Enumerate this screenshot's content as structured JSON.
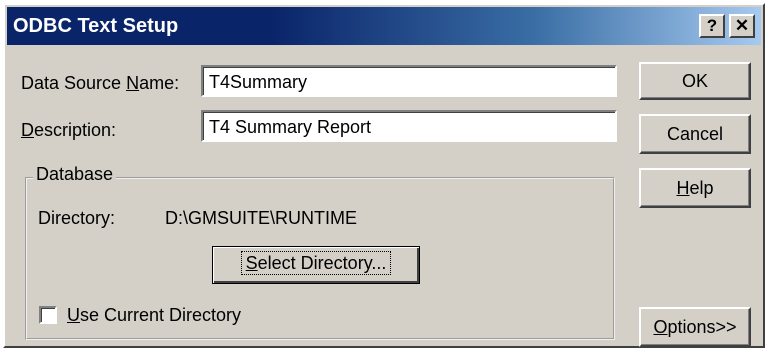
{
  "window": {
    "title": "ODBC Text Setup",
    "help_glyph": "?",
    "close_glyph": "✕"
  },
  "form": {
    "dsn_label_pre": "Data Source ",
    "dsn_label_key": "N",
    "dsn_label_post": "ame:",
    "dsn_value": "T4Summary",
    "desc_label_key": "D",
    "desc_label_post": "escription:",
    "desc_value": "T4 Summary Report"
  },
  "database": {
    "legend": "Database",
    "directory_label": "Directory:",
    "directory_value": "D:\\GMSUITE\\RUNTIME",
    "select_key": "S",
    "select_post": "elect Directory...",
    "use_current_key": "U",
    "use_current_post": "se Current Directory",
    "use_current_checked": false
  },
  "buttons": {
    "ok": "OK",
    "cancel": "Cancel",
    "help_key": "H",
    "help_post": "elp",
    "options_key": "O",
    "options_post": "ptions>>"
  },
  "colors": {
    "face": "#d4d0c8",
    "titlebar_start": "#0a246a",
    "titlebar_end": "#a6caf0"
  }
}
